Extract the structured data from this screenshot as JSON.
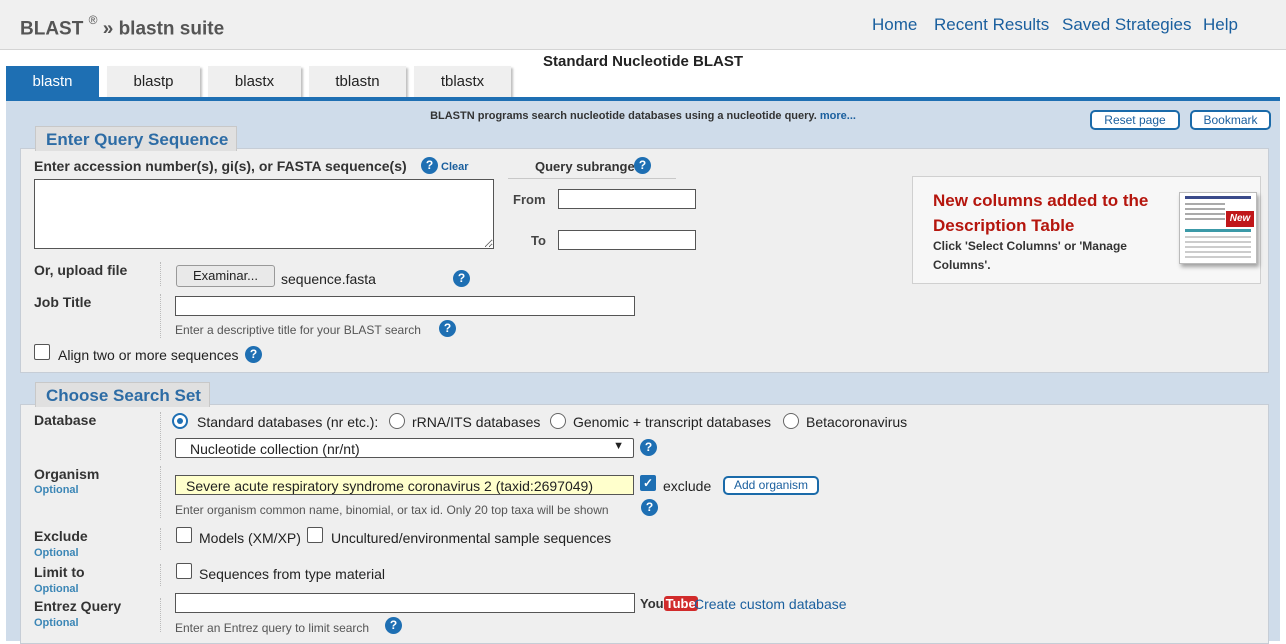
{
  "header": {
    "brand": "BLAST",
    "brand_reg": "®",
    "brand_suffix": "» blastn suite",
    "nav": [
      "Home",
      "Recent Results",
      "Saved Strategies",
      "Help"
    ]
  },
  "page_title": "Standard Nucleotide BLAST",
  "tabs": [
    {
      "label": "blastn",
      "active": true
    },
    {
      "label": "blastp",
      "active": false
    },
    {
      "label": "blastx",
      "active": false
    },
    {
      "label": "tblastn",
      "active": false
    },
    {
      "label": "tblastx",
      "active": false
    }
  ],
  "intro": {
    "text": "BLASTN programs search nucleotide databases using a nucleotide query.",
    "more": "more..."
  },
  "buttons": {
    "reset": "Reset page",
    "bookmark": "Bookmark"
  },
  "query_section": {
    "legend": "Enter Query Sequence",
    "accession_label": "Enter accession number(s), gi(s), or FASTA sequence(s)",
    "clear_link": "Clear",
    "sequence_value": "",
    "subrange_label": "Query subrange",
    "from_label": "From",
    "to_label": "To",
    "from_value": "",
    "to_value": "",
    "upload_label": "Or, upload file",
    "browse_button": "Examinar...",
    "file_name": "sequence.fasta",
    "job_title_label": "Job Title",
    "job_title_value": "",
    "job_title_hint": "Enter a descriptive title for your BLAST search",
    "align_label": "Align two or more sequences",
    "align_checked": false
  },
  "notice": {
    "title": "New columns added to the Description Table",
    "body": "Click 'Select Columns' or 'Manage Columns'.",
    "badge": "New"
  },
  "search_section": {
    "legend": "Choose Search Set",
    "database_label": "Database",
    "database_options": [
      {
        "label": "Standard databases (nr etc.):",
        "selected": true
      },
      {
        "label": "rRNA/ITS databases",
        "selected": false
      },
      {
        "label": "Genomic + transcript databases",
        "selected": false
      },
      {
        "label": "Betacoronavirus",
        "selected": false
      }
    ],
    "database_select": "Nucleotide collection (nr/nt)",
    "organism_label": "Organism",
    "optional": "Optional",
    "organism_value": "Severe acute respiratory syndrome coronavirus 2 (taxid:2697049)",
    "exclude_label": "exclude",
    "exclude_checked": true,
    "add_organism": "Add organism",
    "organism_hint": "Enter organism common name, binomial, or tax id. Only 20 top taxa will be shown",
    "exclude_section_label": "Exclude",
    "exclude_models": "Models (XM/XP)",
    "exclude_uncultured": "Uncultured/environmental sample sequences",
    "limit_label": "Limit to",
    "limit_type_material": "Sequences from type material",
    "entrez_label": "Entrez Query",
    "entrez_value": "",
    "youtube_you": "You",
    "youtube_tube": "Tube",
    "create_db_link": "Create custom database",
    "entrez_hint": "Enter an Entrez query to limit search"
  },
  "colors": {
    "accent": "#1e6fb3",
    "link": "#1a5f9e",
    "legend": "#2d6ca5",
    "notice_title": "#b5160e",
    "organism_bg": "#ffffcc"
  }
}
